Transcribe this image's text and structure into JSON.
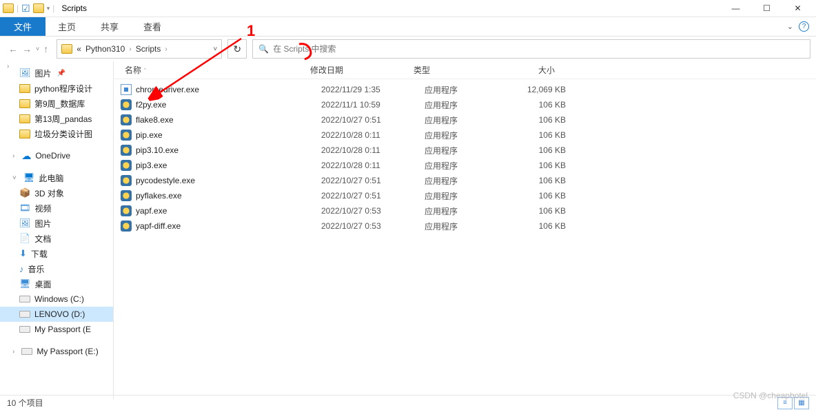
{
  "window": {
    "title": "Scripts"
  },
  "ribbon": {
    "file": "文件",
    "home": "主页",
    "share": "共享",
    "view": "查看"
  },
  "breadcrumb": {
    "prefix": "«",
    "parent": "Python310",
    "current": "Scripts"
  },
  "search": {
    "placeholder": "在 Scripts 中搜索"
  },
  "sidebar": {
    "pictures": "图片",
    "py_proj": "python程序设计",
    "week9": "第9周_数据库",
    "week13": "第13周_pandas",
    "trash_design": "垃圾分类设计图",
    "onedrive": "OneDrive",
    "thispc": "此电脑",
    "d3": "3D 对象",
    "video": "视频",
    "pictures2": "图片",
    "docs": "文档",
    "downloads": "下载",
    "music": "音乐",
    "desktop": "桌面",
    "win_c": "Windows (C:)",
    "lenovo_d": "LENOVO (D:)",
    "passport_e": "My Passport (E",
    "passport_e2": "My Passport (E:)"
  },
  "columns": {
    "name": "名称",
    "date": "修改日期",
    "type": "类型",
    "size": "大小"
  },
  "files": [
    {
      "name": "chromedriver.exe",
      "date": "2022/11/29 1:35",
      "type": "应用程序",
      "size": "12,069 KB",
      "icon": "exe"
    },
    {
      "name": "f2py.exe",
      "date": "2022/11/1 10:59",
      "type": "应用程序",
      "size": "106 KB",
      "icon": "py"
    },
    {
      "name": "flake8.exe",
      "date": "2022/10/27 0:51",
      "type": "应用程序",
      "size": "106 KB",
      "icon": "py"
    },
    {
      "name": "pip.exe",
      "date": "2022/10/28 0:11",
      "type": "应用程序",
      "size": "106 KB",
      "icon": "py"
    },
    {
      "name": "pip3.10.exe",
      "date": "2022/10/28 0:11",
      "type": "应用程序",
      "size": "106 KB",
      "icon": "py"
    },
    {
      "name": "pip3.exe",
      "date": "2022/10/28 0:11",
      "type": "应用程序",
      "size": "106 KB",
      "icon": "py"
    },
    {
      "name": "pycodestyle.exe",
      "date": "2022/10/27 0:51",
      "type": "应用程序",
      "size": "106 KB",
      "icon": "py"
    },
    {
      "name": "pyflakes.exe",
      "date": "2022/10/27 0:51",
      "type": "应用程序",
      "size": "106 KB",
      "icon": "py"
    },
    {
      "name": "yapf.exe",
      "date": "2022/10/27 0:53",
      "type": "应用程序",
      "size": "106 KB",
      "icon": "py"
    },
    {
      "name": "yapf-diff.exe",
      "date": "2022/10/27 0:53",
      "type": "应用程序",
      "size": "106 KB",
      "icon": "py"
    }
  ],
  "statusbar": {
    "count": "10 个项目"
  },
  "watermark": "CSDN @cheaphotel",
  "annotations": {
    "mark1": "1"
  }
}
